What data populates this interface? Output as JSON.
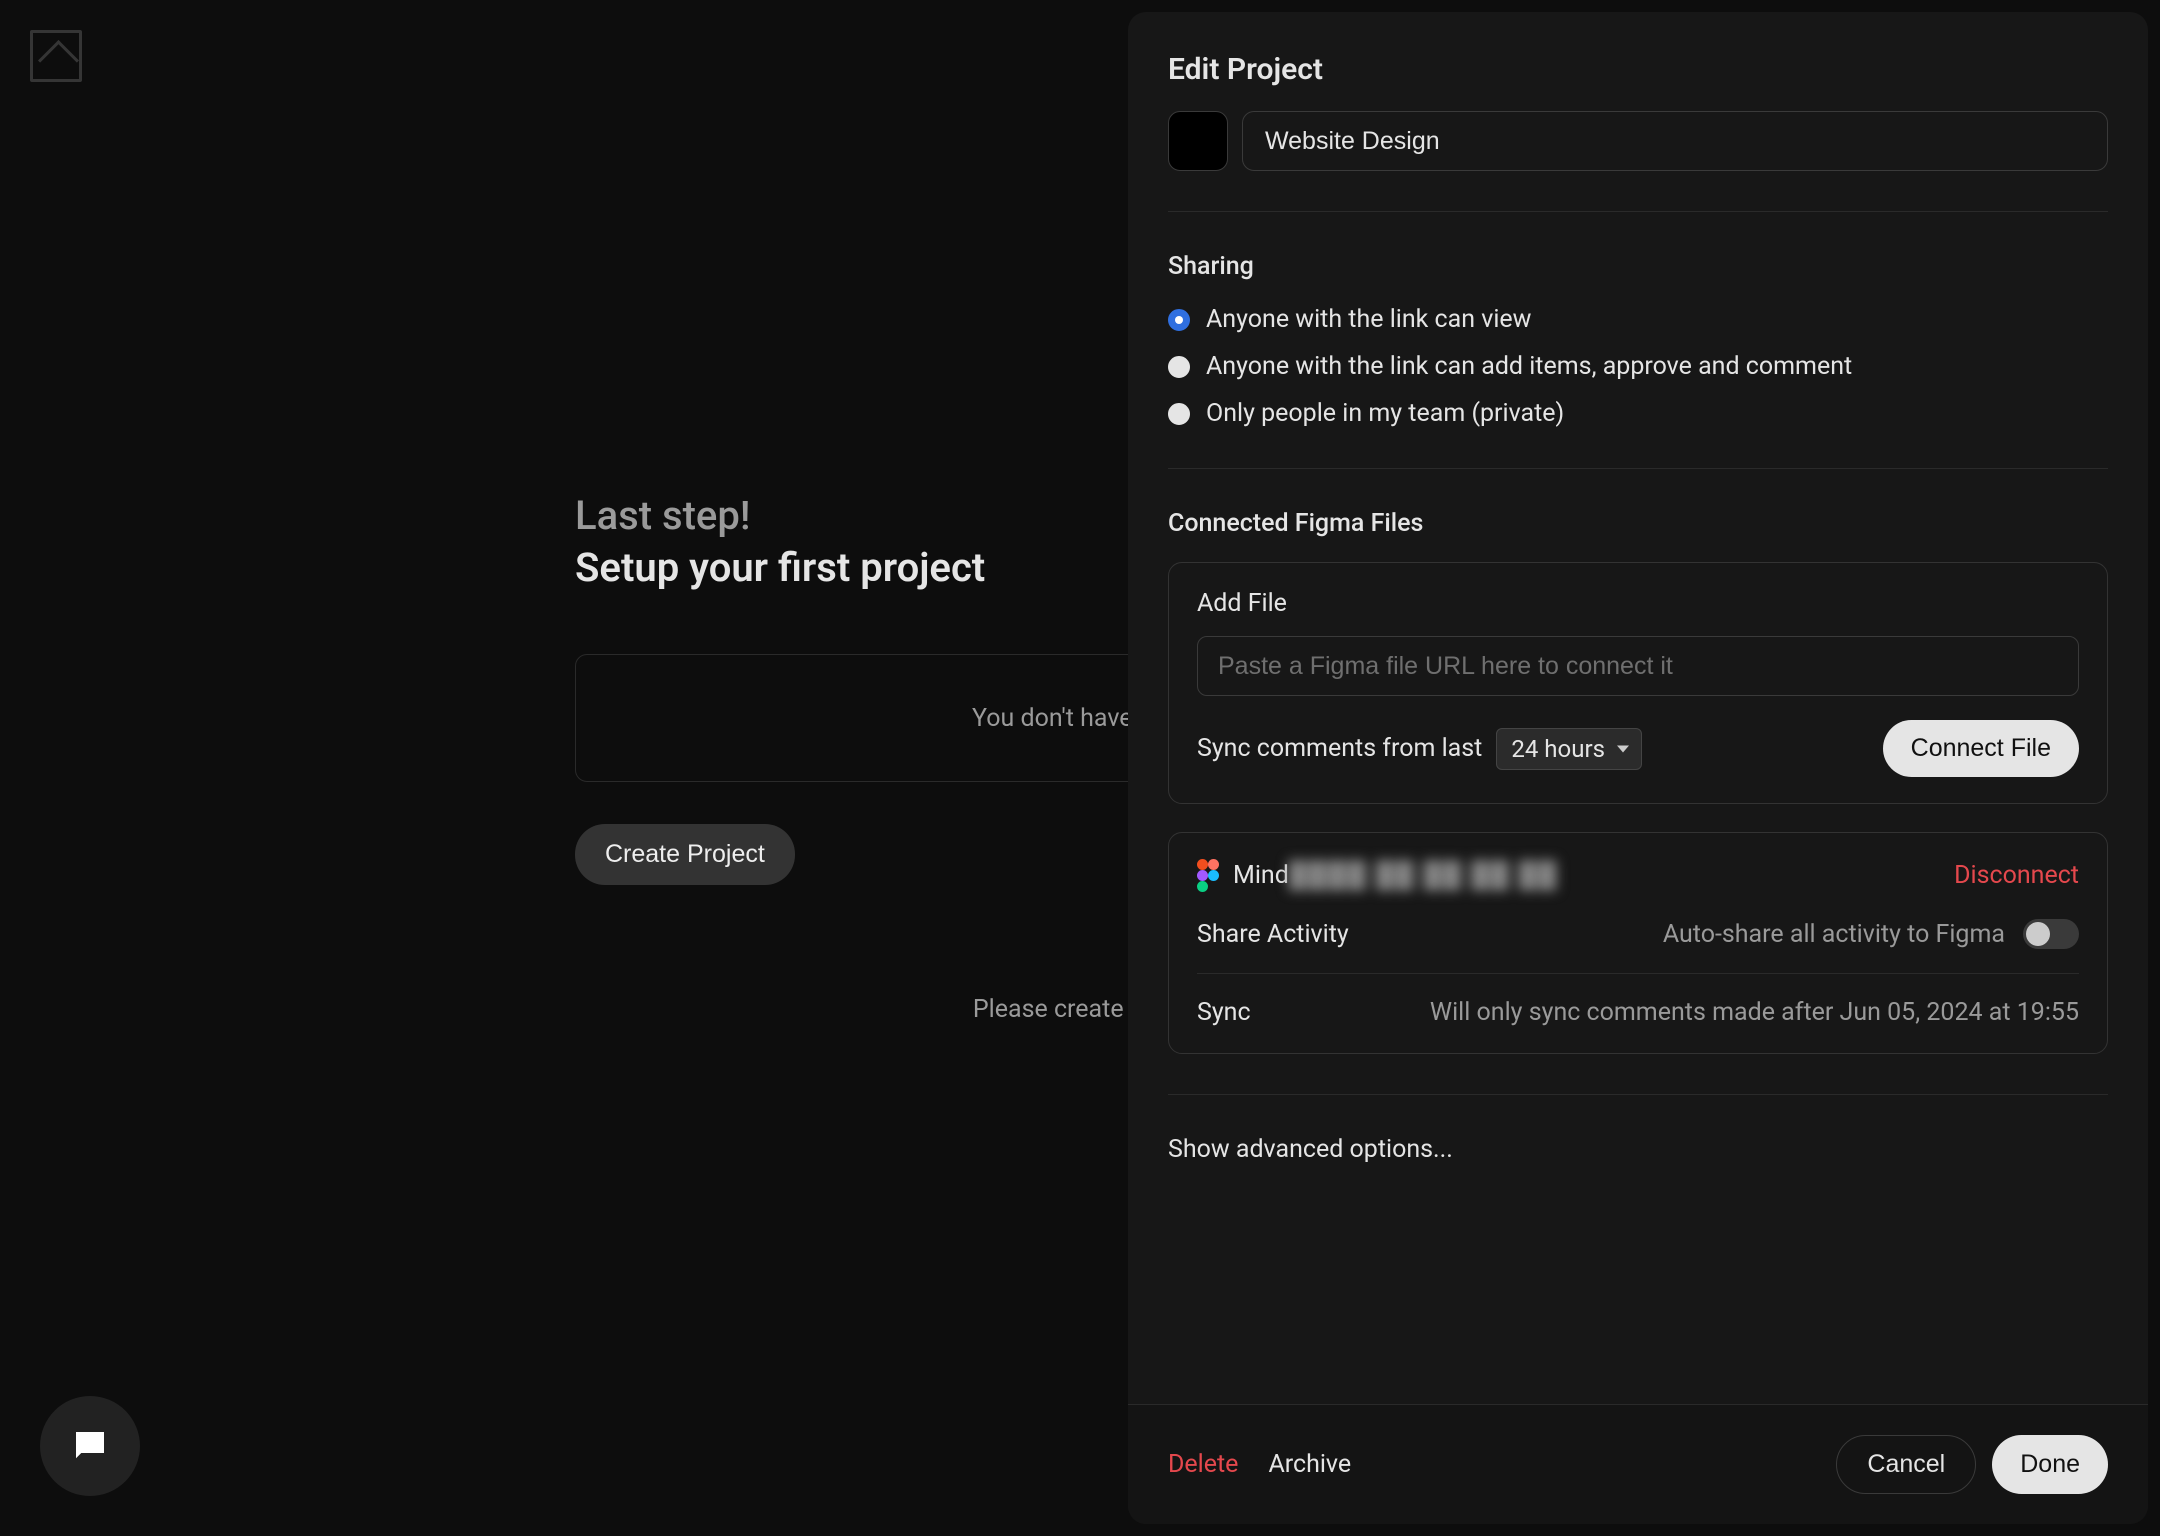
{
  "background": {
    "heading_muted": "Last step!",
    "heading_strong": "Setup your first project",
    "empty_box_text": "You don't have any",
    "create_button": "Create Project",
    "hint_text": "Please create at le"
  },
  "panel": {
    "title": "Edit Project",
    "project_name": "Website Design",
    "sharing": {
      "heading": "Sharing",
      "options": [
        {
          "label": "Anyone with the link can view",
          "selected": true
        },
        {
          "label": "Anyone with the link can add items, approve and comment",
          "selected": false
        },
        {
          "label": "Only people in my team (private)",
          "selected": false
        }
      ]
    },
    "figma": {
      "heading": "Connected Figma Files",
      "add_file_label": "Add File",
      "url_placeholder": "Paste a Figma file URL here to connect it",
      "sync_prefix": "Sync comments from last",
      "sync_window": "24 hours",
      "connect_button": "Connect File",
      "connected_file": {
        "name_visible_prefix": "Mind",
        "obfuscated_part": "████ ██ ██ ██ ██",
        "disconnect_label": "Disconnect",
        "share_activity_label": "Share Activity",
        "share_activity_desc": "Auto-share all activity to Figma",
        "sync_label": "Sync",
        "sync_desc": "Will only sync comments made after Jun 05, 2024 at 19:55"
      }
    },
    "advanced_link": "Show advanced options...",
    "footer": {
      "delete": "Delete",
      "archive": "Archive",
      "cancel": "Cancel",
      "done": "Done"
    }
  }
}
